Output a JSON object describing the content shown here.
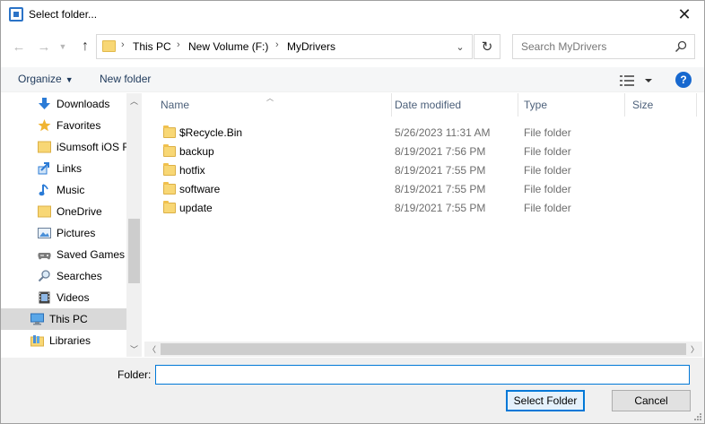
{
  "window": {
    "title": "Select folder...",
    "accent": "#0078d7"
  },
  "address": {
    "crumbs": [
      "This PC",
      "New Volume (F:)",
      "MyDrivers"
    ]
  },
  "search": {
    "placeholder": "Search MyDrivers"
  },
  "toolbar": {
    "organize_label": "Organize",
    "new_folder_label": "New folder",
    "help_label": "?"
  },
  "nav": {
    "items": [
      {
        "label": "Downloads",
        "icon": "download-arrow-icon"
      },
      {
        "label": "Favorites",
        "icon": "star-icon"
      },
      {
        "label": "iSumsoft iOS R",
        "icon": "folder-icon"
      },
      {
        "label": "Links",
        "icon": "link-arrow-icon"
      },
      {
        "label": "Music",
        "icon": "music-note-icon"
      },
      {
        "label": "OneDrive",
        "icon": "folder-icon"
      },
      {
        "label": "Pictures",
        "icon": "picture-icon"
      },
      {
        "label": "Saved Games",
        "icon": "gamepad-icon"
      },
      {
        "label": "Searches",
        "icon": "magnifier-icon"
      },
      {
        "label": "Videos",
        "icon": "film-icon"
      },
      {
        "label": "This PC",
        "icon": "monitor-icon"
      },
      {
        "label": "Libraries",
        "icon": "library-icon"
      }
    ]
  },
  "columns": {
    "name": "Name",
    "date": "Date modified",
    "type": "Type",
    "size": "Size"
  },
  "files": [
    {
      "name": "$Recycle.Bin",
      "date": "5/26/2023 11:31 AM",
      "type": "File folder"
    },
    {
      "name": "backup",
      "date": "8/19/2021 7:56 PM",
      "type": "File folder"
    },
    {
      "name": "hotfix",
      "date": "8/19/2021 7:55 PM",
      "type": "File folder"
    },
    {
      "name": "software",
      "date": "8/19/2021 7:55 PM",
      "type": "File folder"
    },
    {
      "name": "update",
      "date": "8/19/2021 7:55 PM",
      "type": "File folder"
    }
  ],
  "footer": {
    "folder_label": "Folder:",
    "folder_value": "",
    "select_label": "Select Folder",
    "cancel_label": "Cancel"
  }
}
